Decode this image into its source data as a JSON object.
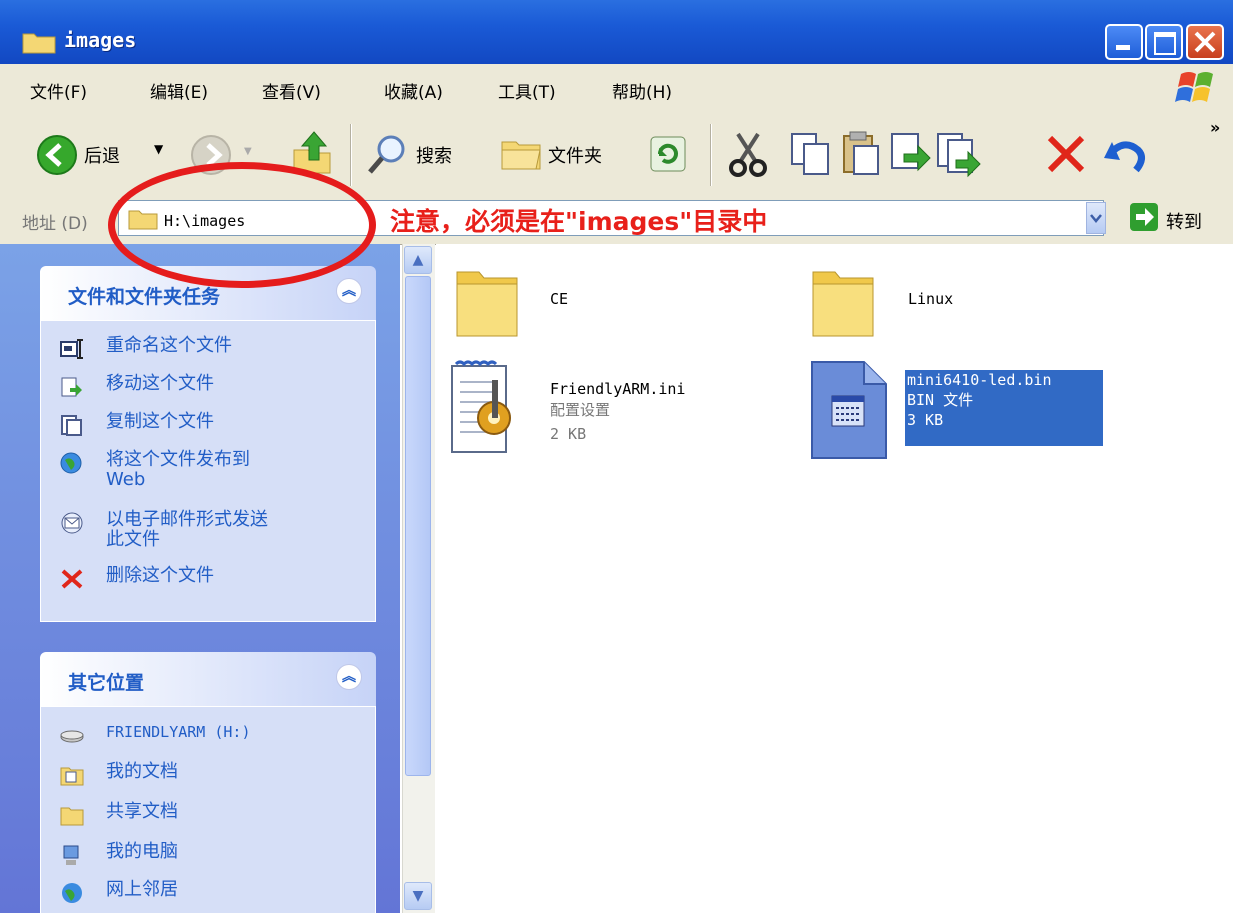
{
  "window": {
    "title": "images",
    "buttons": {
      "minimize": "minimize",
      "maximize": "maximize",
      "close": "close"
    }
  },
  "menu": [
    "文件(F)",
    "编辑(E)",
    "查看(V)",
    "收藏(A)",
    "工具(T)",
    "帮助(H)"
  ],
  "toolbar": {
    "back_label": "后退",
    "search_label": "搜索",
    "folders_label": "文件夹",
    "more": "»"
  },
  "address": {
    "label": "地址 (D)",
    "value": "H:\\images",
    "go_label": "转到",
    "annotation": "注意，必须是在\"images\"目录中"
  },
  "task_pane": {
    "file_tasks": {
      "title": "文件和文件夹任务",
      "items": [
        "重命名这个文件",
        "移动这个文件",
        "复制这个文件",
        "将这个文件发布到\nWeb",
        "以电子邮件形式发送\n此文件",
        "删除这个文件"
      ]
    },
    "other_places": {
      "title": "其它位置",
      "items": [
        "FRIENDLYARM (H:)",
        "我的文档",
        "共享文档",
        "我的电脑",
        "网上邻居"
      ]
    }
  },
  "files": [
    {
      "name": "CE",
      "type": "folder"
    },
    {
      "name": "Linux",
      "type": "folder"
    },
    {
      "name": "FriendlyARM.ini",
      "desc": "配置设置",
      "size": "2 KB",
      "type": "ini"
    },
    {
      "name": "mini6410-led.bin",
      "desc": "BIN 文件",
      "size": "3 KB",
      "type": "bin",
      "selected": true
    }
  ],
  "colors": {
    "titlebar": "#1a5ad6",
    "annotation": "#e8201a",
    "task_link": "#215dc6",
    "selection": "#316ac5"
  }
}
